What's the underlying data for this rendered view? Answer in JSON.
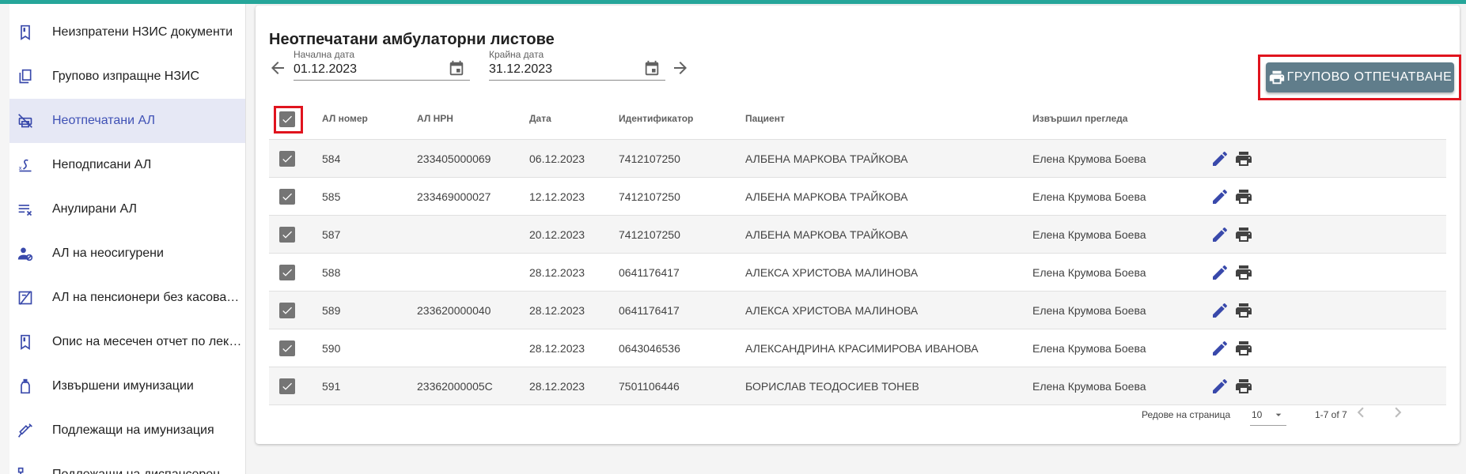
{
  "colors": {
    "accent_bar": "#26a69a",
    "active_item": "#3f51b5",
    "button_bg": "#607d8b",
    "highlight": "#e0141e",
    "icon_blue": "#3949ab"
  },
  "sidebar": {
    "items": [
      {
        "label": "Неизпратени НЗИС документи",
        "icon": "bookmark-icon"
      },
      {
        "label": "Групово изпращне НЗИС",
        "icon": "copy-icon"
      },
      {
        "label": "Неотпечатани АЛ",
        "icon": "print-disabled-icon",
        "active": true
      },
      {
        "label": "Неподписани АЛ",
        "icon": "signature-icon"
      },
      {
        "label": "Анулирани АЛ",
        "icon": "clear-all-icon"
      },
      {
        "label": "АЛ на неосигурени",
        "icon": "person-off-icon"
      },
      {
        "label": "АЛ на пенсионери без касова бележка",
        "icon": "receipt-off-icon"
      },
      {
        "label": "Опис на месечен отчет по лекарствата",
        "icon": "bookmark-icon"
      },
      {
        "label": "Извършени имунизации",
        "icon": "vaccine-bottle-icon"
      },
      {
        "label": "Подлежащи на имунизация",
        "icon": "syringe-icon"
      },
      {
        "label": "Подлежащи на диспансерен преглед",
        "icon": "tree-icon"
      }
    ]
  },
  "page": {
    "title": "Неотпечатани амбулаторни листове"
  },
  "filters": {
    "start_label": "Начална дата",
    "start_value": "01.12.2023",
    "end_label": "Крайна дата",
    "end_value": "31.12.2023"
  },
  "toolbar": {
    "print_label": "ГРУПОВО ОТПЕЧАТВАНЕ"
  },
  "table": {
    "headers": {
      "number": "АЛ номер",
      "nrn": "АЛ НРН",
      "date": "Дата",
      "identifier": "Идентификатор",
      "patient": "Пациент",
      "doctor": "Извършил прегледа"
    },
    "rows": [
      {
        "number": "584",
        "nrn": "233405000069",
        "date": "06.12.2023",
        "identifier": "7412107250",
        "patient": "АЛБЕНА МАРКОВА ТРАЙКОВА",
        "doctor": "Елена Крумова Боева"
      },
      {
        "number": "585",
        "nrn": "233469000027",
        "date": "12.12.2023",
        "identifier": "7412107250",
        "patient": "АЛБЕНА МАРКОВА ТРАЙКОВА",
        "doctor": "Елена Крумова Боева"
      },
      {
        "number": "587",
        "nrn": "",
        "date": "20.12.2023",
        "identifier": "7412107250",
        "patient": "АЛБЕНА МАРКОВА ТРАЙКОВА",
        "doctor": "Елена Крумова Боева"
      },
      {
        "number": "588",
        "nrn": "",
        "date": "28.12.2023",
        "identifier": "0641176417",
        "patient": "АЛЕКСА ХРИСТОВА МАЛИНОВА",
        "doctor": "Елена Крумова Боева"
      },
      {
        "number": "589",
        "nrn": "233620000040",
        "date": "28.12.2023",
        "identifier": "0641176417",
        "patient": "АЛЕКСА ХРИСТОВА МАЛИНОВА",
        "doctor": "Елена Крумова Боева"
      },
      {
        "number": "590",
        "nrn": "",
        "date": "28.12.2023",
        "identifier": "0643046536",
        "patient": "АЛЕКСАНДРИНА КРАСИМИРОВА ИВАНОВА",
        "doctor": "Елена Крумова Боева"
      },
      {
        "number": "591",
        "nrn": "23362000005C",
        "date": "28.12.2023",
        "identifier": "7501106446",
        "patient": "БОРИСЛАВ ТЕОДОСИЕВ ТОНЕВ",
        "doctor": "Елена Крумова Боева"
      }
    ]
  },
  "pagination": {
    "rows_per_page_label": "Редове на страница",
    "rows_per_page": "10",
    "range": "1-7 of 7"
  }
}
